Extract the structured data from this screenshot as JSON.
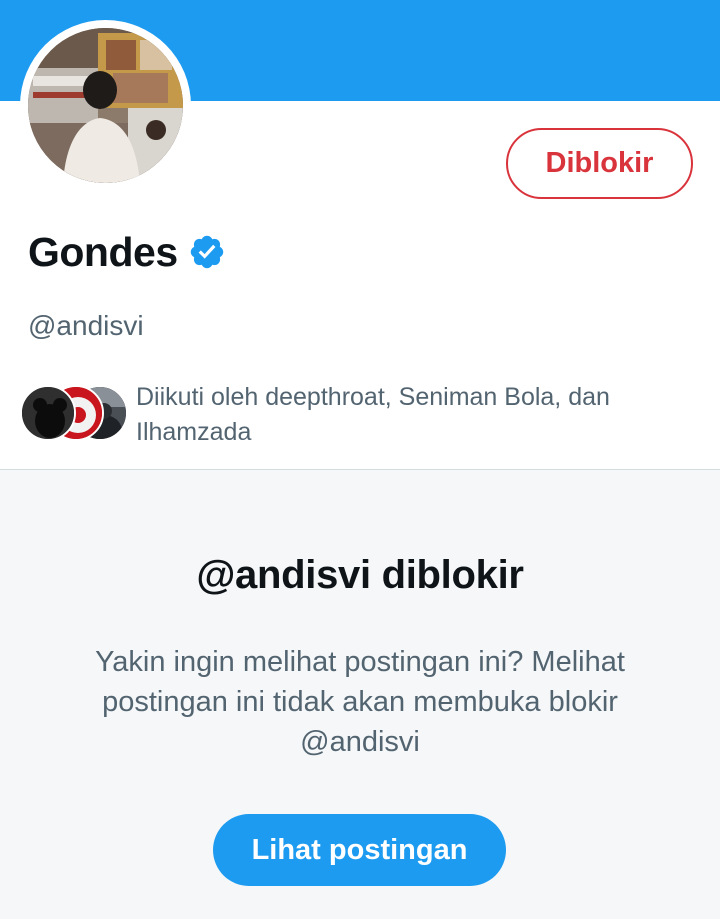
{
  "profile": {
    "display_name": "Gondes",
    "handle": "@andisvi",
    "verified_icon": "verified-badge-icon",
    "blocked_button_label": "Diblokir"
  },
  "followers": {
    "text": "Diikuti oleh deepthroat, Seniman Bola, dan Ilhamzada",
    "avatars": [
      "follower-avatar-1",
      "follower-avatar-2",
      "follower-avatar-3"
    ]
  },
  "blocked_notice": {
    "title": "@andisvi diblokir",
    "message": "Yakin ingin melihat postingan ini? Melihat postingan ini tidak akan membuka blokir @andisvi",
    "view_button_label": "Lihat postingan"
  },
  "colors": {
    "banner": "#1d9bf0",
    "accent_blue": "#1d9bf0",
    "blocked_red": "#d9333c",
    "secondary_text": "#536471",
    "panel_bg": "#f5f7f8"
  }
}
